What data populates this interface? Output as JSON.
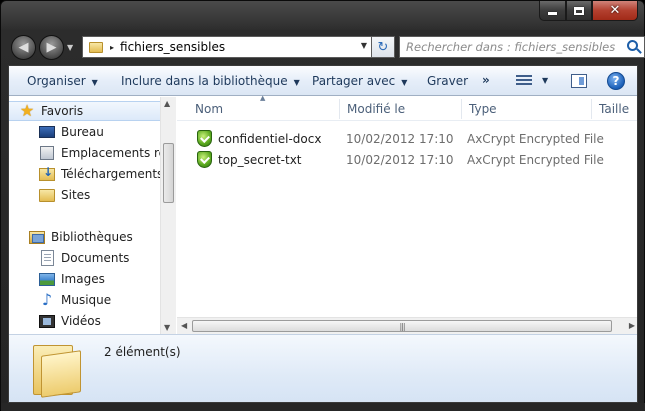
{
  "window": {
    "caption": {
      "minimize": "–",
      "close": "✕"
    }
  },
  "address_bar": {
    "path_separator": "▸",
    "current_folder": "fichiers_sensibles",
    "dropdown": "▼"
  },
  "search": {
    "placeholder": "Rechercher dans : fichiers_sensibles"
  },
  "navigation": {
    "back": "◀",
    "forward": "▶",
    "history_dropdown": "▼",
    "refresh": "↻"
  },
  "toolbar": {
    "organize": "Organiser",
    "include_in_library": "Inclure dans la bibliothèque",
    "share_with": "Partager avec",
    "burn": "Graver",
    "more": "»",
    "caret": "▼",
    "help": "?"
  },
  "sidebar": {
    "favorites": "Favoris",
    "items_favorites": [
      "Bureau",
      "Emplacements réc",
      "Téléchargements",
      "Sites"
    ],
    "libraries": "Bibliothèques",
    "items_libraries": [
      "Documents",
      "Images",
      "Musique",
      "Vidéos"
    ],
    "scroll_up": "▲",
    "scroll_down": "▼"
  },
  "columns": {
    "name": "Nom",
    "modified": "Modifié le",
    "type": "Type",
    "size": "Taille",
    "sort_indicator": "▲"
  },
  "files": [
    {
      "name": "confidentiel-docx",
      "modified": "10/02/2012 17:10",
      "type": "AxCrypt Encrypted File"
    },
    {
      "name": "top_secret-txt",
      "modified": "10/02/2012 17:10",
      "type": "AxCrypt Encrypted File"
    }
  ],
  "hscroll": {
    "left": "◀",
    "right": "▶",
    "grip": "|||"
  },
  "details": {
    "item_count": "2 élément(s)"
  },
  "colors": {
    "frame": "#2c2c2c",
    "toolbar": "#dbe6f4",
    "toolbar_text": "#1e395b",
    "column_header_text": "#4c607a",
    "selected_item": "#dce9f9",
    "details_pane": "#dfeaf7"
  }
}
